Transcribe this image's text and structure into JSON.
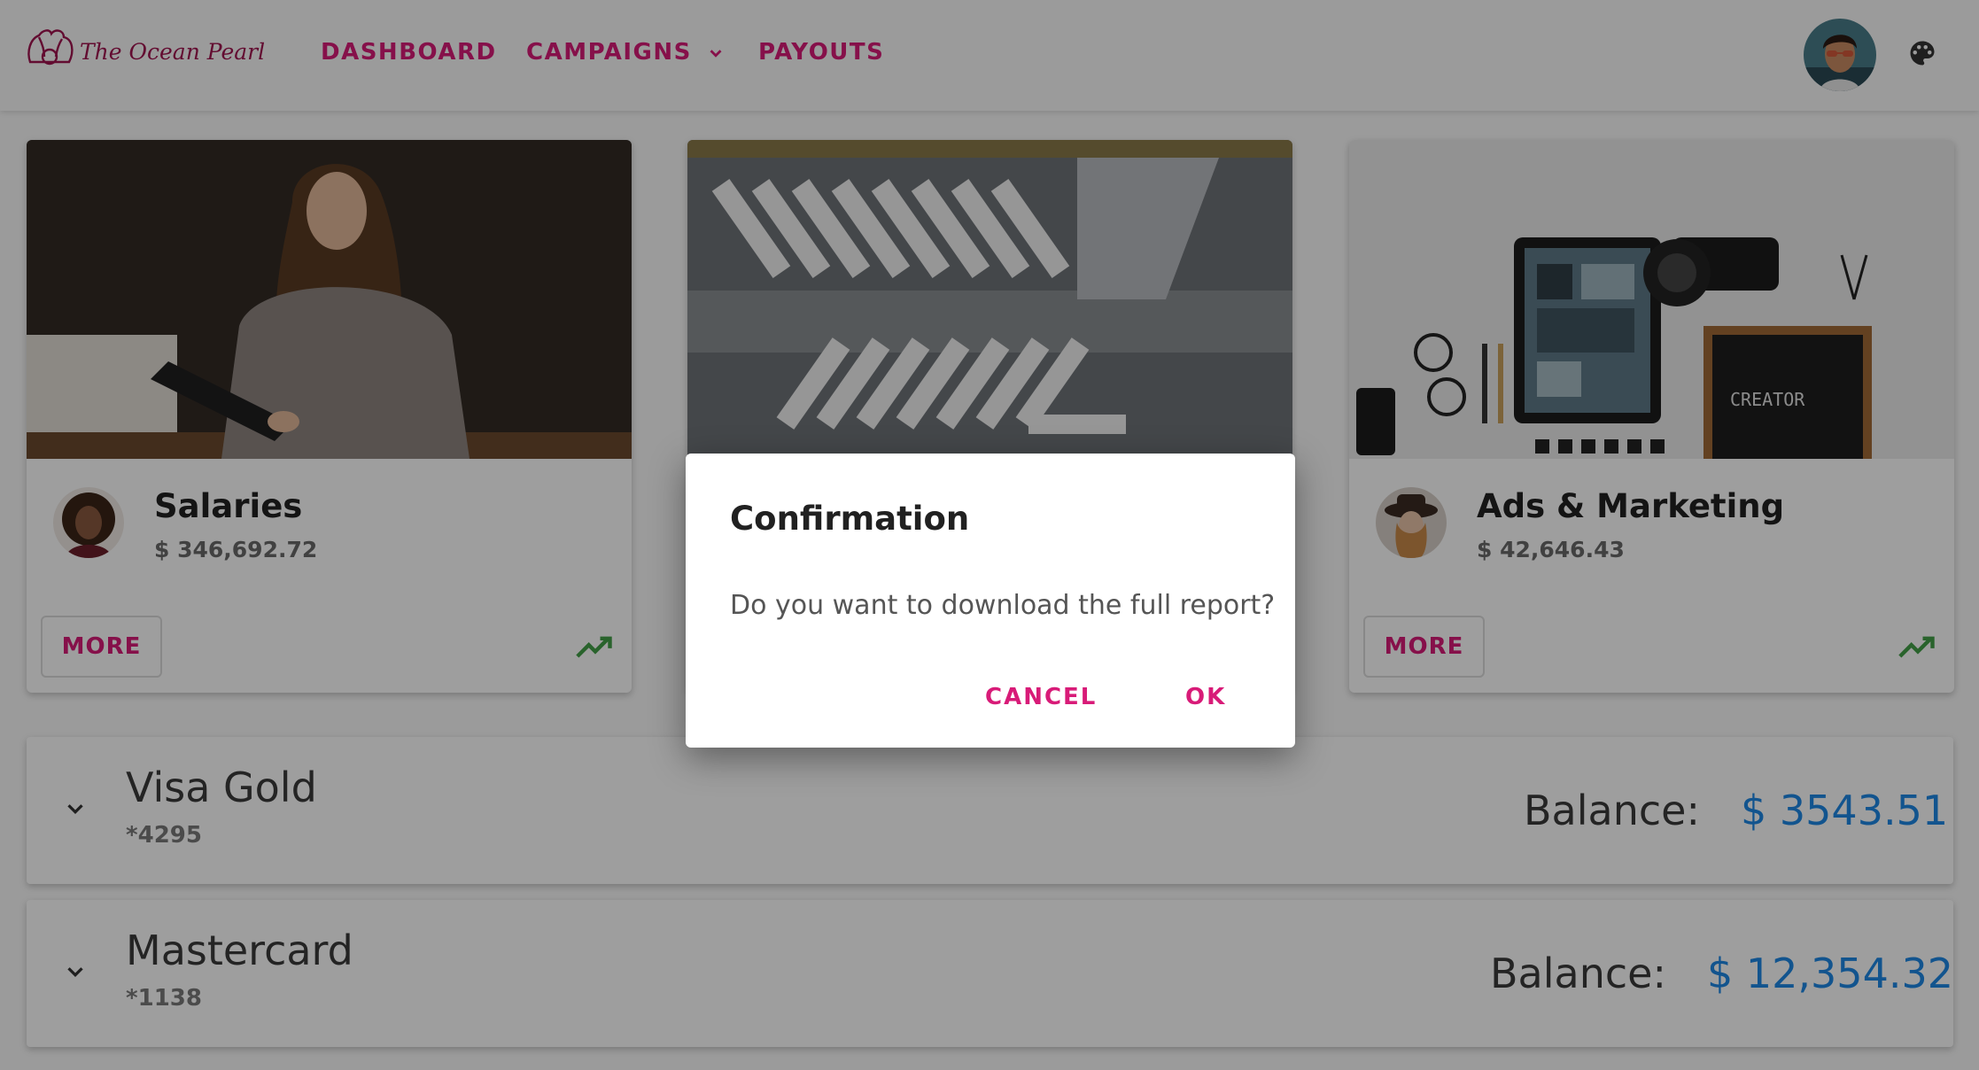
{
  "brand": {
    "name": "The Ocean Pearl",
    "color": "#d81b78"
  },
  "nav": {
    "items": [
      {
        "label": "DASHBOARD"
      },
      {
        "label": "CAMPAIGNS"
      },
      {
        "label": "PAYOUTS"
      }
    ]
  },
  "header": {
    "avatar_icon": "user-avatar",
    "theme_icon": "palette-icon"
  },
  "cards": [
    {
      "title": "Salaries",
      "amount": "$ 346,692.72",
      "button": "MORE",
      "trend_icon": "trending-up-icon"
    },
    {
      "title": "",
      "amount": "",
      "button": "",
      "trend_icon": ""
    },
    {
      "title": "Ads & Marketing",
      "amount": "$ 42,646.43",
      "button": "MORE",
      "trend_icon": "trending-up-icon"
    }
  ],
  "accounts": [
    {
      "name": "Visa Gold",
      "number": "*4295",
      "balance_label": "Balance:",
      "balance": "$ 3543.51"
    },
    {
      "name": "Mastercard",
      "number": "*1138",
      "balance_label": "Balance:",
      "balance": "$ 12,354.32"
    }
  ],
  "dialog": {
    "title": "Confirmation",
    "message": "Do you want to download the full report?",
    "cancel_label": "CANCEL",
    "ok_label": "OK"
  },
  "colors": {
    "accent": "#d81b78",
    "balance": "#1e88e5",
    "trend": "#43a047"
  }
}
